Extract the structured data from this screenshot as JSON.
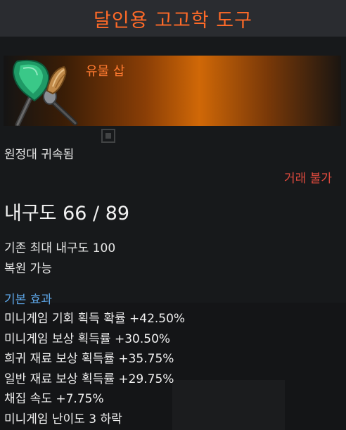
{
  "title": "달인용 고고학 도구",
  "item": {
    "name": "유물 삽",
    "icon": "shovel-and-brush-icon"
  },
  "bind_status": "원정대 귀속됨",
  "trade_status": "거래 불가",
  "durability": "내구도 66 / 89",
  "existing_max_durability": "기존 최대 내구도 100",
  "restorable": "복원 가능",
  "effects": {
    "header": "기본 효과",
    "items": [
      "미니게임 기회 획득 확률 +42.50%",
      "미니게임 보상 획득률 +30.50%",
      "희귀 재료 보상 획득률 +35.75%",
      "일반 재료 보상 획득률 +29.75%",
      "채집 속도 +7.75%",
      "미니게임 난이도 3 하락"
    ]
  },
  "colors": {
    "title": "#ff6a28",
    "item_name": "#ff7a30",
    "trade_status": "#e04a3e",
    "section_header": "#5da6e8",
    "background": "#17191b"
  }
}
